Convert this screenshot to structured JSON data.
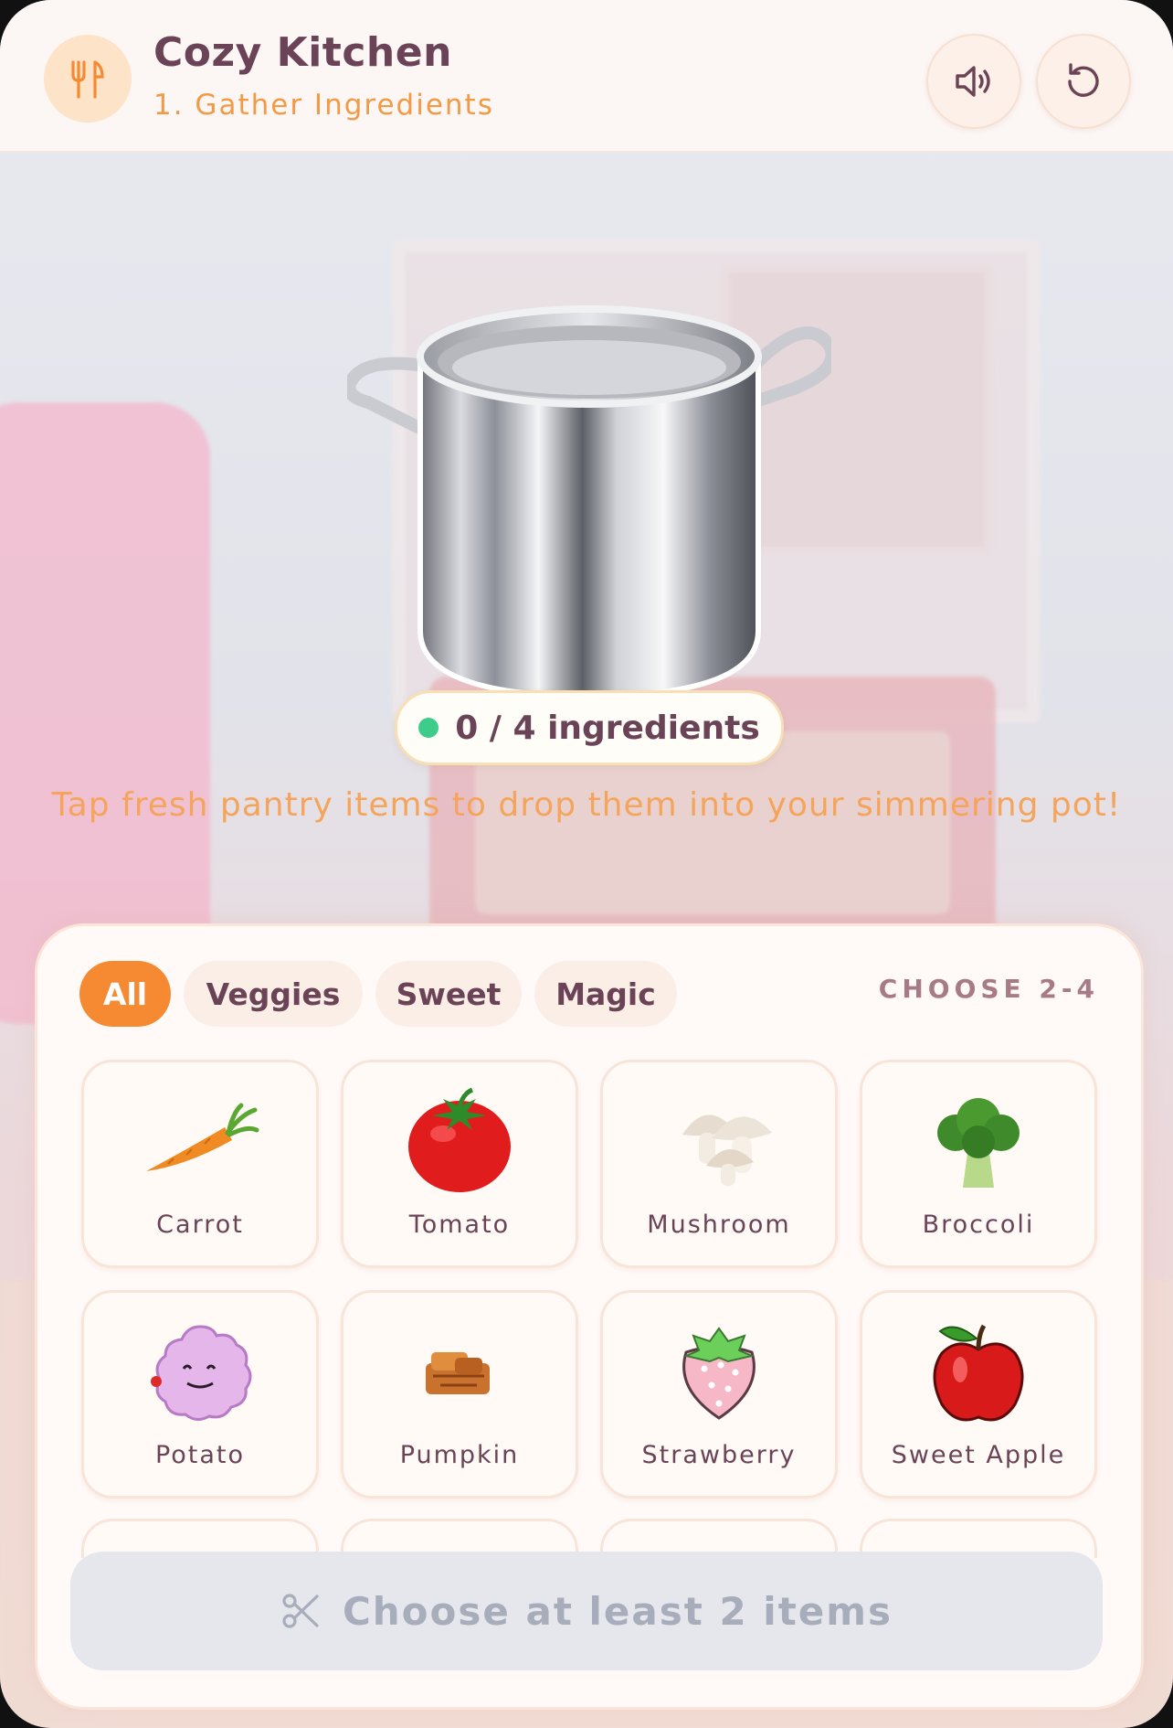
{
  "app": {
    "title": "Cozy Kitchen",
    "step": "1. Gather Ingredients"
  },
  "header_buttons": {
    "sound_icon": "speaker-icon",
    "reset_icon": "restart-icon"
  },
  "pot": {
    "counter": "0 / 4 ingredients",
    "hint": "Tap fresh pantry items to drop them into your simmering pot!"
  },
  "filters": {
    "tabs": [
      {
        "label": "All",
        "active": true
      },
      {
        "label": "Veggies",
        "active": false
      },
      {
        "label": "Sweet",
        "active": false
      },
      {
        "label": "Magic",
        "active": false
      }
    ],
    "choose_label": "CHOOSE 2-4"
  },
  "ingredients": [
    {
      "name": "Carrot",
      "icon": "carrot-icon"
    },
    {
      "name": "Tomato",
      "icon": "tomato-icon"
    },
    {
      "name": "Mushroom",
      "icon": "mushroom-icon"
    },
    {
      "name": "Broccoli",
      "icon": "broccoli-icon"
    },
    {
      "name": "Potato",
      "icon": "potato-icon"
    },
    {
      "name": "Pumpkin",
      "icon": "pumpkin-icon"
    },
    {
      "name": "Strawberry",
      "icon": "strawberry-icon"
    },
    {
      "name": "Sweet Apple",
      "icon": "apple-icon"
    }
  ],
  "cook_button": {
    "label": "Choose at least 2 items",
    "icon": "scissors-icon"
  },
  "colors": {
    "accent": "#f58a32",
    "title": "#6b4356",
    "status_dot": "#3dcc8a"
  }
}
